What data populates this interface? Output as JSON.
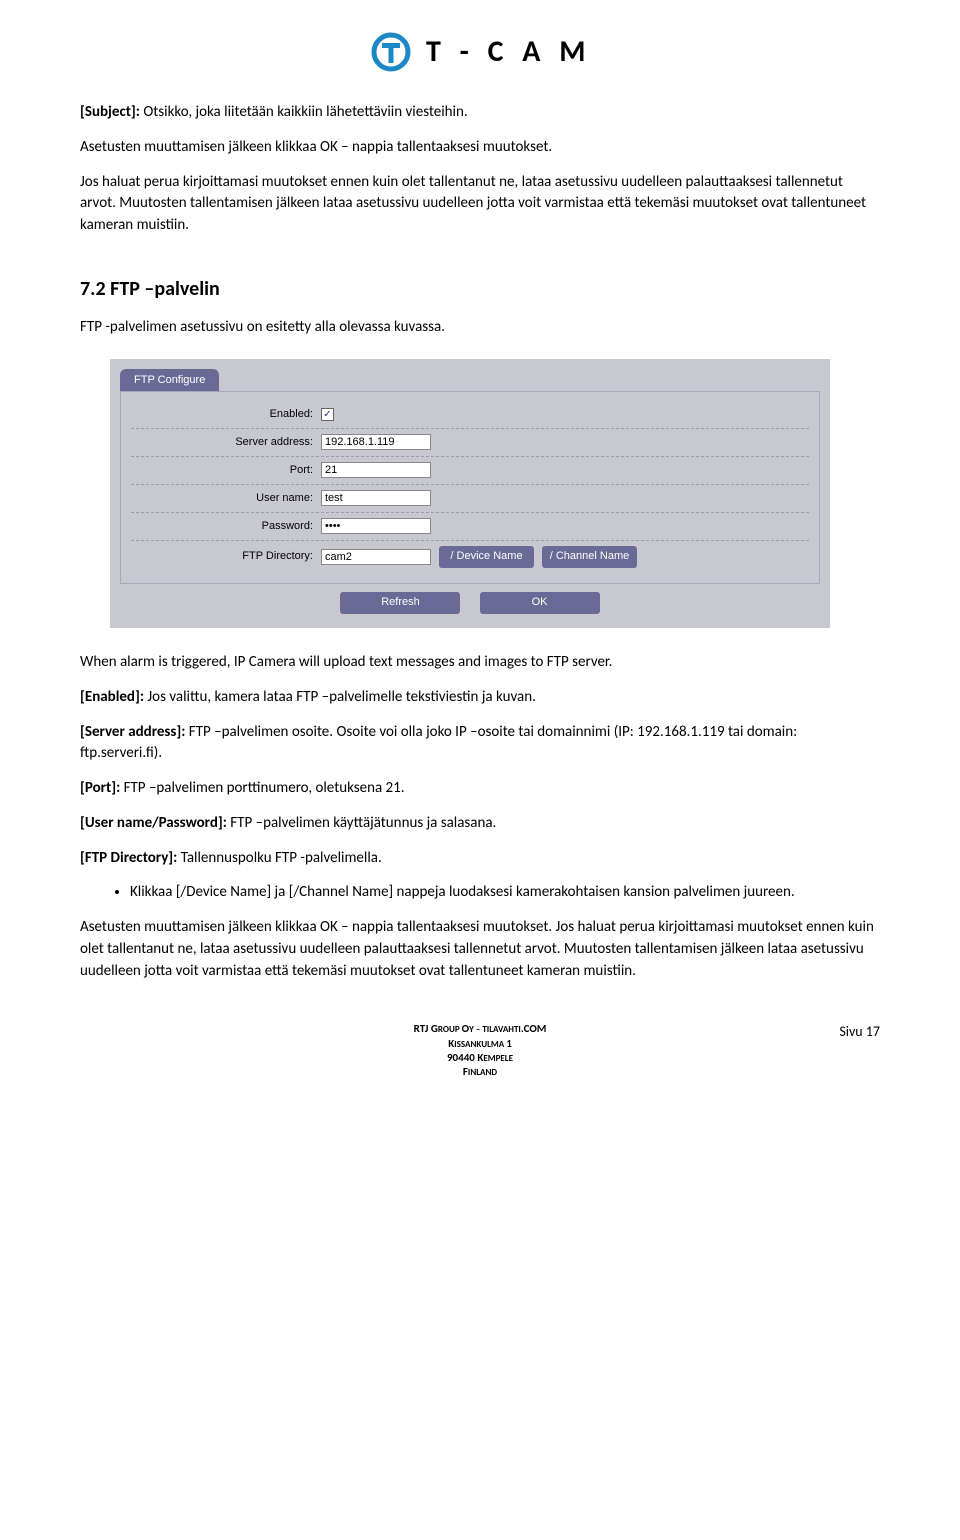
{
  "logo_text": "T - C A M",
  "body": {
    "p1_label": "[Subject]:",
    "p1_text": " Otsikko, joka liitetään kaikkiin lähetettäviin viesteihin.",
    "p2": "Asetusten muuttamisen jälkeen klikkaa OK – nappia tallentaaksesi muutokset.",
    "p3": "Jos haluat perua kirjoittamasi muutokset ennen kuin olet tallentanut ne, lataa asetussivu uudelleen palauttaaksesi tallennetut arvot. Muutosten tallentamisen jälkeen lataa asetussivu uudelleen jotta voit varmistaa että tekemäsi muutokset ovat tallentuneet kameran muistiin.",
    "section_heading": "7.2  FTP –palvelin",
    "p4": "FTP -palvelimen asetussivu on esitetty alla olevassa kuvassa.",
    "p5": "When alarm is triggered, IP Camera will upload text messages and images to FTP server.",
    "p6_label": "[Enabled]:",
    "p6_text": " Jos valittu, kamera lataa FTP –palvelimelle tekstiviestin ja kuvan.",
    "p7_label": "[Server address]:",
    "p7_text": " FTP –palvelimen osoite. Osoite voi olla joko IP –osoite tai domainnimi (IP: 192.168.1.119 tai domain: ftp.serveri.fi).",
    "p8_label": "[Port]:",
    "p8_text": " FTP –palvelimen porttinumero, oletuksena 21.",
    "p9_label": "[User name/Password]:",
    "p9_text": " FTP –palvelimen käyttäjätunnus ja salasana.",
    "p10_label": "[FTP Directory]:",
    "p10_text": " Tallennuspolku FTP -palvelimella.",
    "bullet1": "Klikkaa [/Device Name] ja [/Channel Name] nappeja luodaksesi kamerakohtaisen kansion palvelimen juureen.",
    "p11": "Asetusten muuttamisen jälkeen klikkaa OK – nappia tallentaaksesi muutokset. Jos haluat perua kirjoittamasi muutokset ennen kuin olet tallentanut ne, lataa asetussivu uudelleen palauttaaksesi tallennetut arvot. Muutosten tallentamisen jälkeen lataa asetussivu uudelleen jotta voit varmistaa että tekemäsi muutokset ovat tallentuneet kameran muistiin."
  },
  "ftp_panel": {
    "tab": "FTP Configure",
    "rows": {
      "enabled_label": "Enabled:",
      "enabled_checked": "✓",
      "server_label": "Server address:",
      "server_value": "192.168.1.119",
      "port_label": "Port:",
      "port_value": "21",
      "user_label": "User name:",
      "user_value": "test",
      "pass_label": "Password:",
      "pass_value": "••••",
      "dir_label": "FTP Directory:",
      "dir_value": "cam2",
      "btn_device": "/ Device Name",
      "btn_channel": "/ Channel Name"
    },
    "btn_refresh": "Refresh",
    "btn_ok": "OK"
  },
  "footer": {
    "l1a": "RTJ G",
    "l1b": "ROUP ",
    "l1c": "O",
    "l1d": "Y – T",
    "l1e": "ILAVAHTI",
    "l1f": ".COM",
    "l2a": "K",
    "l2b": "ISSANKULMA ",
    "l2c": "1",
    "l3a": "90440 K",
    "l3b": "EMPELE",
    "l4a": "F",
    "l4b": "INLAND",
    "page": "Sivu 17"
  }
}
